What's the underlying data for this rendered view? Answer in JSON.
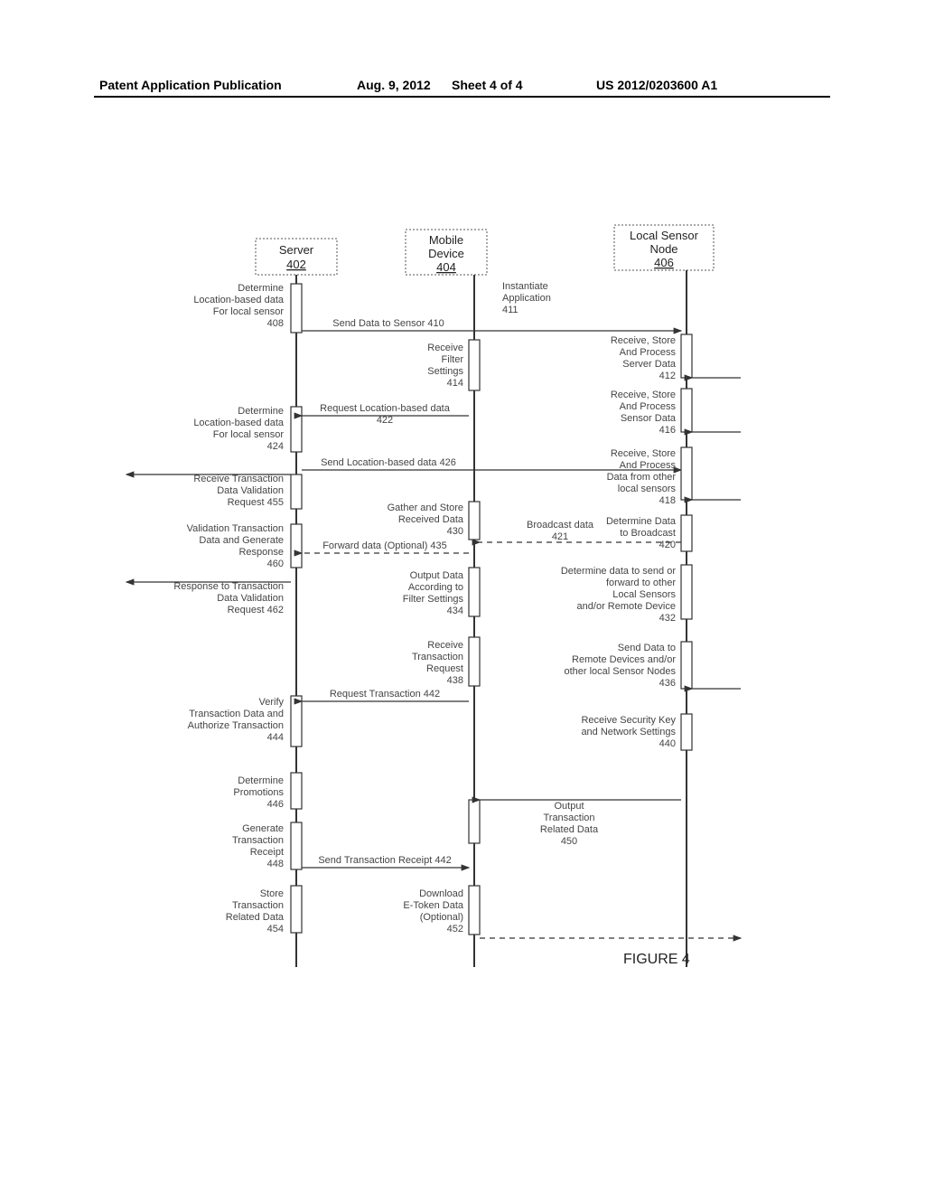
{
  "header": {
    "left": "Patent Application Publication",
    "date": "Aug. 9, 2012",
    "sheet": "Sheet 4 of 4",
    "pubno": "US 2012/0203600 A1"
  },
  "lifelines": {
    "server": {
      "title1": "Server",
      "title2": "402"
    },
    "mobile": {
      "title1": "Mobile",
      "title2": "Device",
      "title3": "404"
    },
    "sensor": {
      "title1": "Local Sensor",
      "title2": "Node",
      "title3": "406"
    }
  },
  "labels": {
    "s408a": "Determine",
    "s408b": "Location-based data",
    "s408c": "For local sensor",
    "s408d": "408",
    "m410": "Send Data to Sensor 410",
    "s411a": "Instantiate",
    "s411b": "Application",
    "s411c": "411",
    "s412a": "Receive, Store",
    "s412b": "And Process",
    "s412c": "Server Data",
    "s412d": "412",
    "s414a": "Receive",
    "s414b": "Filter",
    "s414c": "Settings",
    "s414d": "414",
    "s416a": "Receive, Store",
    "s416b": "And Process",
    "s416c": "Sensor Data",
    "s416d": "416",
    "s418a": "Receive, Store",
    "s418b": "And Process",
    "s418c": "Data from other",
    "s418d": "local sensors",
    "s418e": "418",
    "s420a": "Determine Data",
    "s420b": "to Broadcast",
    "s420c": "420",
    "m421a": "Broadcast data",
    "m421b": "421",
    "m422a": "Request  Location-based data",
    "m422b": "422",
    "s424a": "Determine",
    "s424b": "Location-based data",
    "s424c": "For local sensor",
    "s424d": "424",
    "m426": "Send Location-based data  426",
    "s430a": "Gather and Store",
    "s430b": "Received Data",
    "s430c": "430",
    "s432a": "Determine data to  send or",
    "s432b": "forward to other",
    "s432c": "Local Sensors",
    "s432d": "and/or Remote Device",
    "s432e": "432",
    "s434a": "Output Data",
    "s434b": "According to",
    "s434c": "Filter Settings",
    "s434d": "434",
    "m435": "Forward data (Optional)  435",
    "s436a": "Send Data to",
    "s436b": "Remote Devices and/or",
    "s436c": "other local Sensor Nodes",
    "s436d": "436",
    "s438a": "Receive",
    "s438b": "Transaction",
    "s438c": "Request",
    "s438d": "438",
    "s440a": "Receive Security Key",
    "s440b": "and Network Settings",
    "s440c": "440",
    "m442": "Request Transaction  442",
    "s444a": "Verify",
    "s444b": "Transaction Data and",
    "s444c": "Authorize Transaction",
    "s444d": "444",
    "s446a": "Determine",
    "s446b": "Promotions",
    "s446c": "446",
    "s448a": "Generate",
    "s448b": "Transaction",
    "s448c": "Receipt",
    "s448d": "448",
    "m448s": "Send  Transaction Receipt  442",
    "s450a": "Output",
    "s450b": "Transaction",
    "s450c": "Related Data",
    "s450d": "450",
    "s452a": "Download",
    "s452b": "E-Token Data",
    "s452c": "(Optional)",
    "s452d": "452",
    "s454a": "Store",
    "s454b": "Transaction",
    "s454c": "Related Data",
    "s454d": "454",
    "s455a": "Receive Transaction",
    "s455b": "Data Validation",
    "s455c": "Request 455",
    "s460a": "Validation Transaction",
    "s460b": "Data and Generate",
    "s460c": "Response",
    "s460d": "460",
    "s462a": "Response to Transaction",
    "s462b": "Data Validation",
    "s462c": "Request 462",
    "figure": "FIGURE  4"
  }
}
